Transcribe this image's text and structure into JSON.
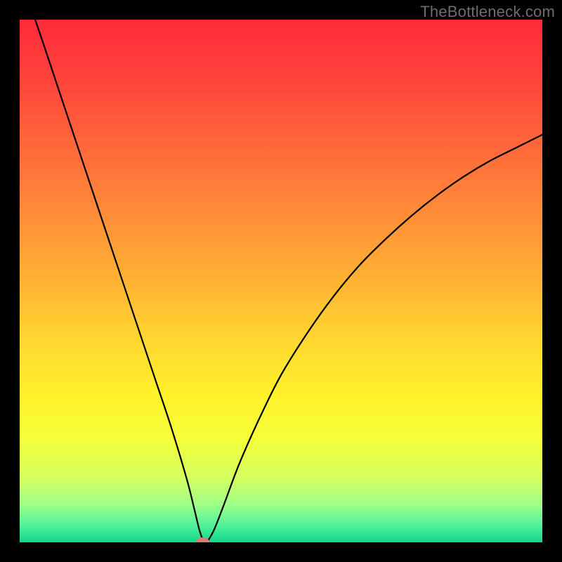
{
  "watermark": "TheBottleneck.com",
  "chart_data": {
    "type": "line",
    "title": "",
    "xlabel": "",
    "ylabel": "",
    "xlim": [
      0,
      100
    ],
    "ylim": [
      0,
      100
    ],
    "grid": false,
    "legend": false,
    "background_gradient": {
      "stops": [
        {
          "offset": 0.0,
          "color": "#ff2a3a"
        },
        {
          "offset": 0.12,
          "color": "#ff453b"
        },
        {
          "offset": 0.25,
          "color": "#ff6a3a"
        },
        {
          "offset": 0.38,
          "color": "#ff8f38"
        },
        {
          "offset": 0.5,
          "color": "#ffb333"
        },
        {
          "offset": 0.62,
          "color": "#ffd92f"
        },
        {
          "offset": 0.72,
          "color": "#fff22a"
        },
        {
          "offset": 0.8,
          "color": "#f6ff3a"
        },
        {
          "offset": 0.88,
          "color": "#d4ff62"
        },
        {
          "offset": 0.93,
          "color": "#9cff8a"
        },
        {
          "offset": 0.97,
          "color": "#4cf09a"
        },
        {
          "offset": 1.0,
          "color": "#0fd68b"
        }
      ]
    },
    "series": [
      {
        "name": "bottleneck-curve",
        "x": [
          0,
          2,
          5,
          8,
          11,
          14,
          17,
          20,
          23,
          26,
          29,
          32,
          33.5,
          34.5,
          35.5,
          37,
          39,
          42,
          46,
          50,
          55,
          60,
          65,
          70,
          75,
          80,
          85,
          90,
          95,
          100
        ],
        "y": [
          110,
          103,
          94,
          85,
          76,
          67,
          58,
          49,
          40,
          31,
          22,
          12,
          6,
          2,
          0,
          2,
          7,
          15,
          24,
          32,
          40,
          47,
          53,
          58,
          62.5,
          66.5,
          70,
          73,
          75.5,
          78
        ]
      }
    ],
    "marker": {
      "name": "optimal-point",
      "x": 35,
      "y": 0,
      "color": "#dd7b78",
      "rx": 9,
      "ry": 5
    }
  }
}
